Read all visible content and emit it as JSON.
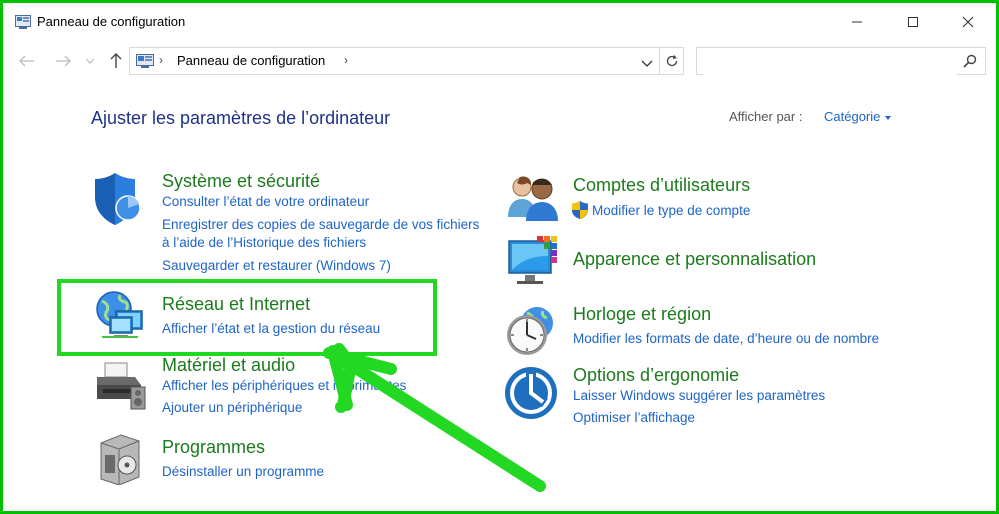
{
  "window": {
    "title": "Panneau de configuration"
  },
  "address": {
    "crumb": "Panneau de configuration",
    "search_placeholder": ""
  },
  "main": {
    "heading": "Ajuster les paramètres de l’ordinateur",
    "view_by_label": "Afficher par :",
    "view_by_value": "Catégorie"
  },
  "categories": {
    "system": {
      "title": "Système et sécurité",
      "links": [
        "Consulter l’état de votre ordinateur",
        "Enregistrer des copies de sauvegarde de vos fichiers",
        "à l’aide de l’Historique des fichiers",
        "Sauvegarder et restaurer (Windows 7)"
      ]
    },
    "network": {
      "title": "Réseau et Internet",
      "links": [
        "Afficher l’état et la gestion du réseau"
      ]
    },
    "hardware": {
      "title": "Matériel et audio",
      "links": [
        "Afficher les périphériques et imprimantes",
        "Ajouter un périphérique"
      ]
    },
    "programs": {
      "title": "Programmes",
      "links": [
        "Désinstaller un programme"
      ]
    },
    "accounts": {
      "title": "Comptes d’utilisateurs",
      "links": [
        "Modifier le type de compte"
      ]
    },
    "appearance": {
      "title": "Apparence et personnalisation",
      "links": []
    },
    "clock": {
      "title": "Horloge et région",
      "links": [
        "Modifier les formats de date, d’heure ou de nombre"
      ]
    },
    "ease": {
      "title": "Options d’ergonomie",
      "links": [
        "Laisser Windows suggérer les paramètres",
        "Optimiser l’affichage"
      ]
    }
  },
  "colors": {
    "title_green": "#1c7b1c",
    "link_blue": "#1e64c8",
    "heading_blue": "#1e3287",
    "annotation_green": "#23d823"
  }
}
